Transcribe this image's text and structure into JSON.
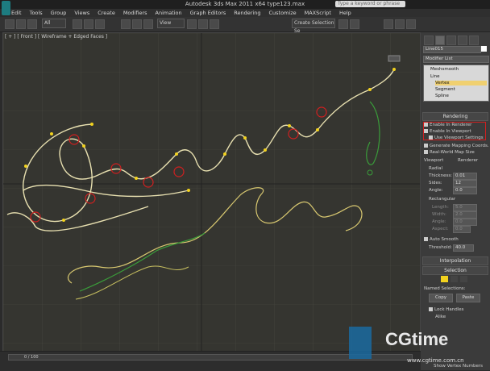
{
  "window": {
    "title": "Autodesk 3ds Max  2011 x64        type123.max",
    "search_placeholder": "Type a keyword or phrase"
  },
  "menu": [
    "Edit",
    "Tools",
    "Group",
    "Views",
    "Create",
    "Modifiers",
    "Animation",
    "Graph Editors",
    "Rendering",
    "Customize",
    "MAXScript",
    "Help"
  ],
  "toolbar": {
    "selection_filter": "All",
    "reference_coord": "View",
    "named_selection": "Create Selection Se"
  },
  "viewport": {
    "label": "[ + ] [ Front ] [ Wireframe + Edged Faces ]"
  },
  "panel": {
    "object_name": "Line015",
    "modifier_list": "Modifier List",
    "stack": [
      "Meshsmooth",
      "Line",
      "Vertex",
      "Segment",
      "Spline"
    ],
    "rendering_title": "Rendering",
    "enable_renderer": "Enable In Renderer",
    "enable_viewport": "Enable In Viewport",
    "use_viewport_settings": "Use Viewport Settings",
    "gen_mapping": "Generate Mapping Coords.",
    "real_world": "Real-World Map Size",
    "viewport_radio": "Viewport",
    "renderer_radio": "Renderer",
    "radial": "Radial",
    "thickness_label": "Thickness:",
    "thickness_value": "0.01",
    "sides_label": "Sides:",
    "sides_value": "12",
    "angle_label": "Angle:",
    "angle_value": "0.0",
    "rectangular": "Rectangular",
    "length_label": "Length:",
    "length_value": "5.0",
    "width_label": "Width:",
    "width_value": "2.0",
    "angle2_label": "Angle:",
    "angle2_value": "0.0",
    "aspect_label": "Aspect:",
    "aspect_value": "0.0",
    "auto_smooth": "Auto Smooth",
    "threshold_label": "Threshold:",
    "threshold_value": "40.0",
    "interpolation": "Interpolation",
    "selection": "Selection",
    "named_selections": "Named Selections:",
    "copy": "Copy",
    "paste": "Paste",
    "lock_handles": "Lock Handles",
    "alike": "Alike",
    "show_vertex_numbers": "Show Vertex Numbers"
  },
  "timeline": {
    "value": "0 / 100"
  },
  "watermark": {
    "text": "CGtime",
    "url": "www.cgtime.com.cn"
  },
  "colors": {
    "curve": "#e8e0b0",
    "vertex": "#f2d21e",
    "selected": "#d02020",
    "accent_green": "#3a9c3a"
  }
}
